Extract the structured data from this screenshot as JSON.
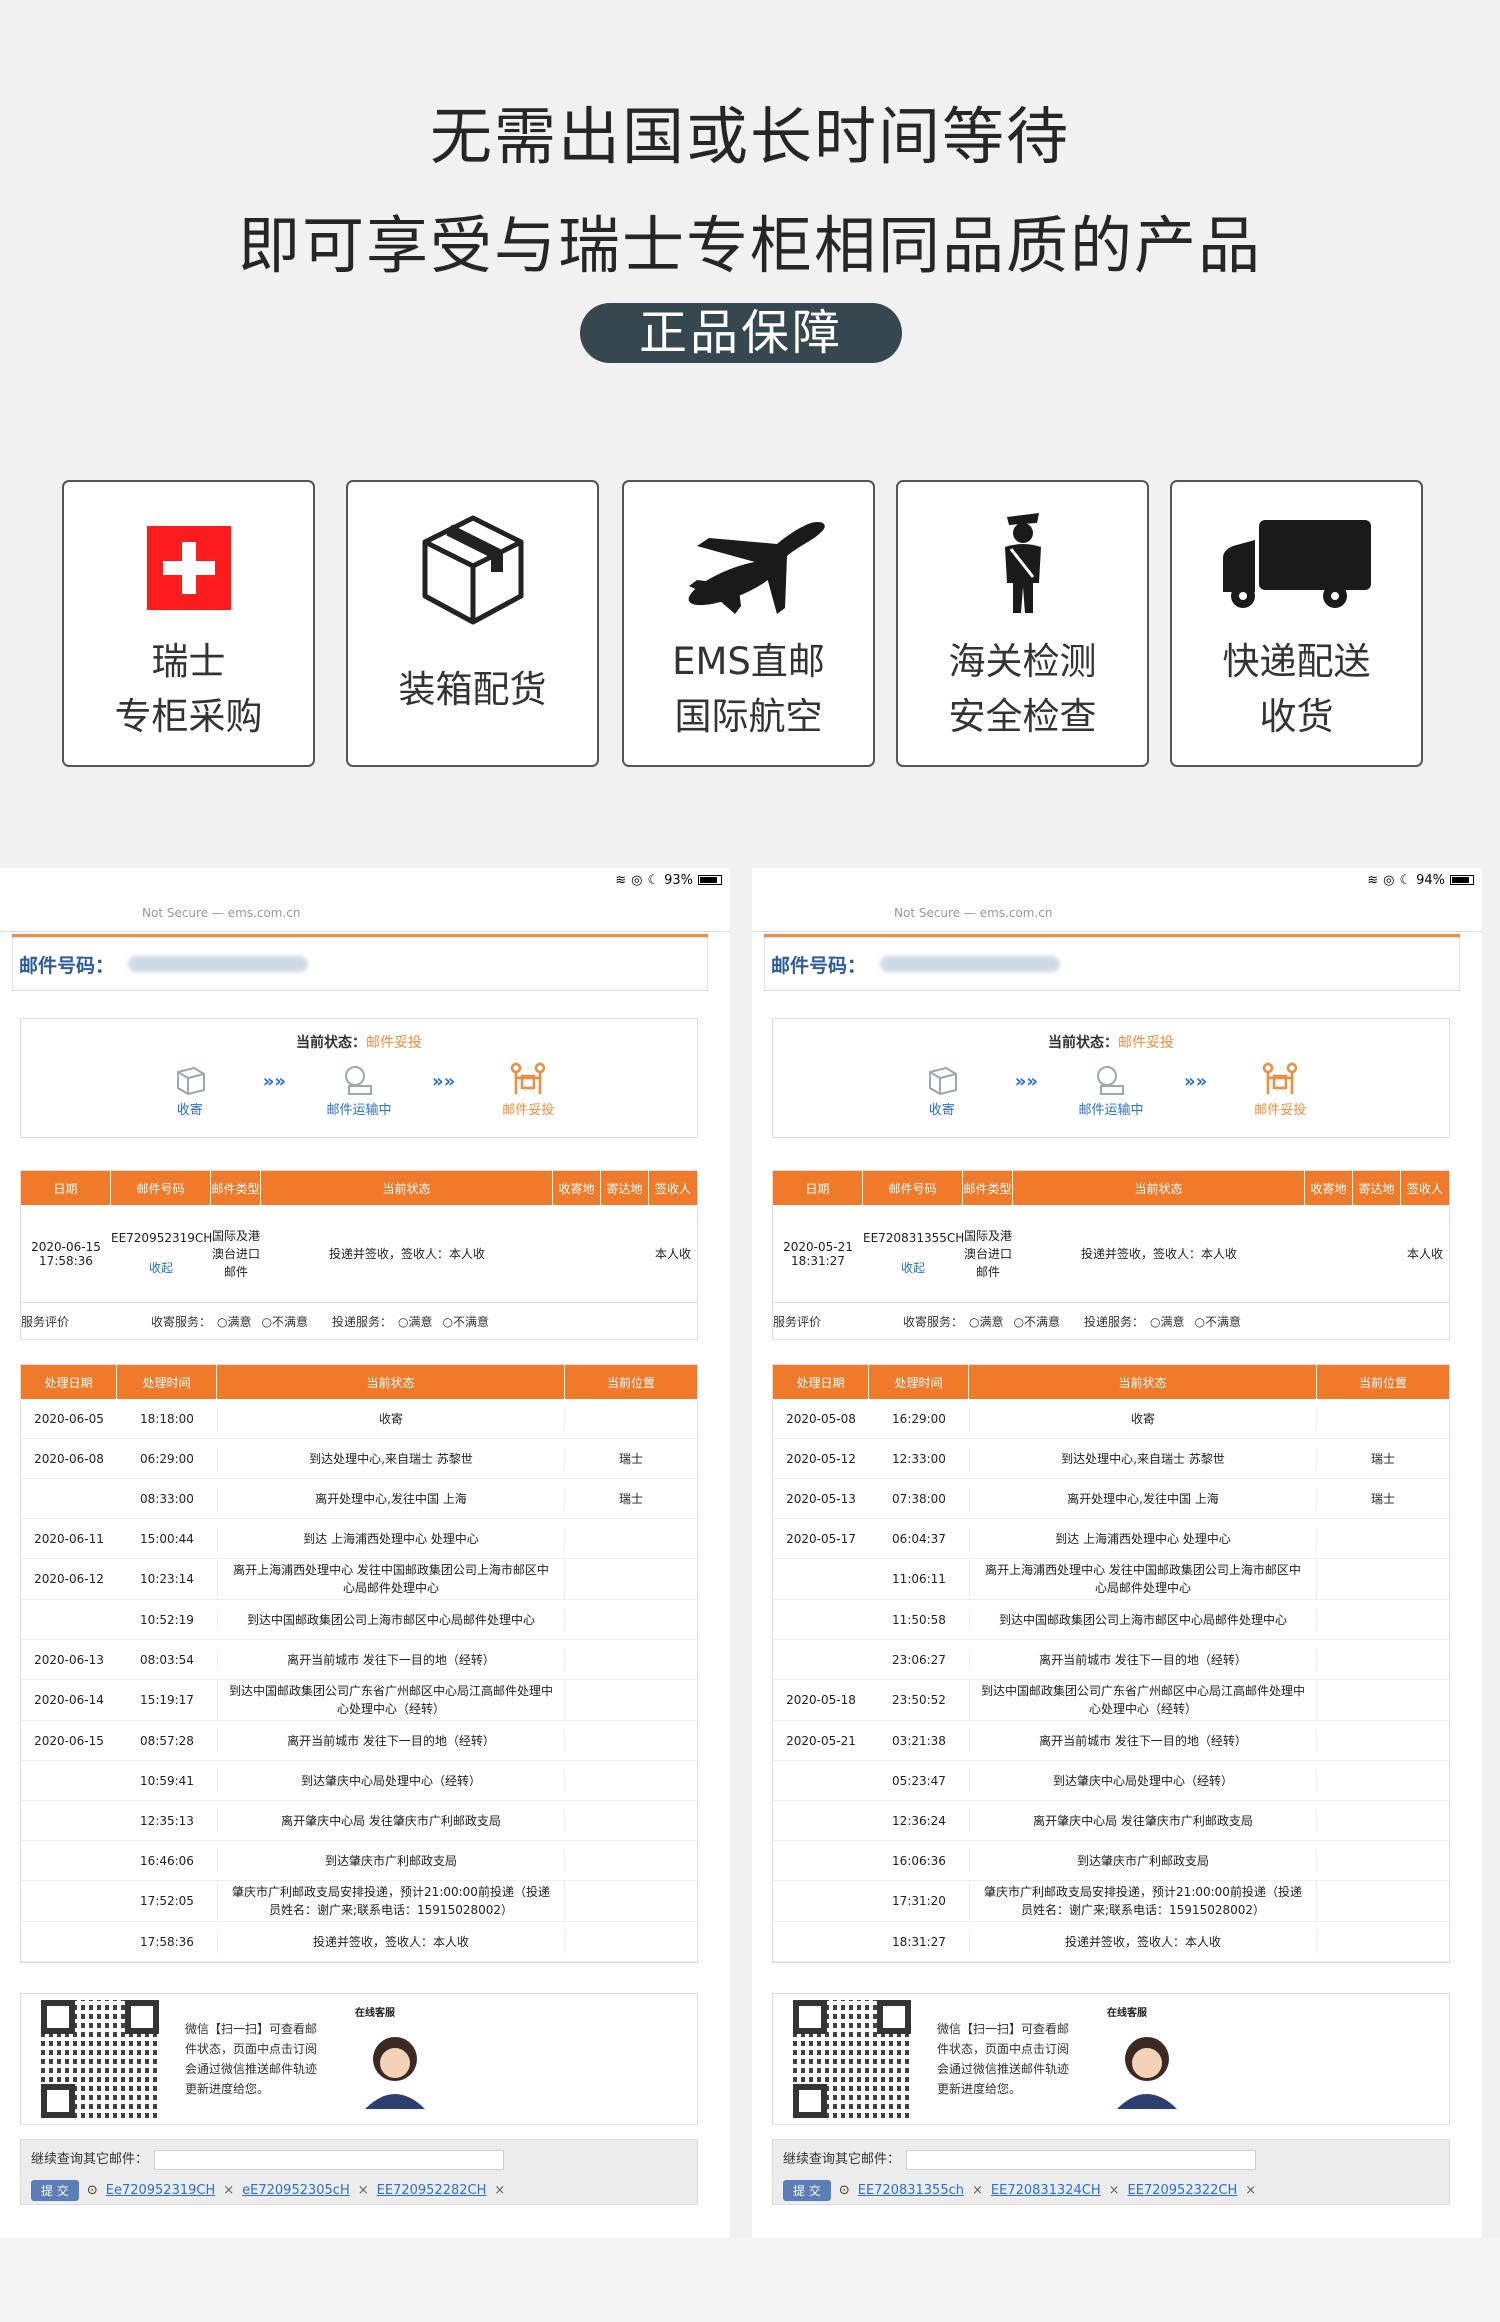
{
  "headline1": "无需出国或长时间等待",
  "headline2": "即可享受与瑞士专柜相同品质的产品",
  "badge": "正品保障",
  "features": [
    {
      "icon": "swiss-flag-icon",
      "l1": "瑞士",
      "l2": "专柜采购"
    },
    {
      "icon": "box-icon",
      "l1": "装箱配货",
      "l2": ""
    },
    {
      "icon": "airplane-icon",
      "l1": "EMS直邮",
      "l2": "国际航空"
    },
    {
      "icon": "customs-officer-icon",
      "l1": "海关检测",
      "l2": "安全检查"
    },
    {
      "icon": "truck-icon",
      "l1": "快递配送",
      "l2": "收货"
    }
  ],
  "shots": [
    {
      "status": {
        "battery": "93%"
      },
      "url": "Not Secure — ems.com.cn",
      "mail_label": "邮件号码：",
      "current_label": "当前状态：",
      "current_value": "邮件妥投",
      "steps": [
        "收寄",
        "邮件运输中",
        "邮件妥投"
      ],
      "t1_headers": [
        "日期",
        "邮件号码",
        "邮件类型",
        "当前状态",
        "收寄地",
        "寄达地",
        "签收人"
      ],
      "t1_row": {
        "date": "2020-06-15 17:58:36",
        "number": "EE720952319CH",
        "collect": "收起",
        "type": "国际及港澳台进口邮件",
        "state": "投递并签收，签收人：本人收",
        "signer": "本人收"
      },
      "service": {
        "label": "服务评价",
        "collect": "收寄服务：",
        "deliver": "投递服务：",
        "sat": "满意",
        "unsat": "不满意"
      },
      "t2_headers": [
        "处理日期",
        "处理时间",
        "当前状态",
        "当前位置"
      ],
      "t2_rows": [
        [
          "2020-06-05",
          "18:18:00",
          "收寄",
          ""
        ],
        [
          "2020-06-08",
          "06:29:00",
          "到达处理中心,来自瑞士 苏黎世",
          "瑞士"
        ],
        [
          "",
          "08:33:00",
          "离开处理中心,发往中国 上海",
          "瑞士"
        ],
        [
          "2020-06-11",
          "15:00:44",
          "到达 上海浦西处理中心 处理中心",
          ""
        ],
        [
          "2020-06-12",
          "10:23:14",
          "离开上海浦西处理中心 发往中国邮政集团公司上海市邮区中心局邮件处理中心",
          ""
        ],
        [
          "",
          "10:52:19",
          "到达中国邮政集团公司上海市邮区中心局邮件处理中心",
          ""
        ],
        [
          "2020-06-13",
          "08:03:54",
          "离开当前城市 发往下一目的地（经转）",
          ""
        ],
        [
          "2020-06-14",
          "15:19:17",
          "到达中国邮政集团公司广东省广州邮区中心局江高邮件处理中心处理中心（经转）",
          ""
        ],
        [
          "2020-06-15",
          "08:57:28",
          "离开当前城市 发往下一目的地（经转）",
          ""
        ],
        [
          "",
          "10:59:41",
          "到达肇庆中心局处理中心（经转）",
          ""
        ],
        [
          "",
          "12:35:13",
          "离开肇庆中心局 发往肇庆市广利邮政支局",
          ""
        ],
        [
          "",
          "16:46:06",
          "到达肇庆市广利邮政支局",
          ""
        ],
        [
          "",
          "17:52:05",
          "肇庆市广利邮政支局安排投递，预计21:00:00前投递（投递员姓名：谢广来;联系电话：15915028002）",
          ""
        ],
        [
          "",
          "17:58:36",
          "投递并签收，签收人：本人收",
          ""
        ]
      ],
      "qr_text": "微信【扫一扫】可查看邮件状态，页面中点击订阅会通过微信推送邮件轨迹更新进度给您。",
      "service_title": "在线客服",
      "more_label": "继续查询其它邮件：",
      "submit": "提 交",
      "history": [
        "Ee720952319CH",
        "eE720952305cH",
        "EE720952282CH"
      ]
    },
    {
      "status": {
        "battery": "94%"
      },
      "url": "Not Secure — ems.com.cn",
      "mail_label": "邮件号码：",
      "current_label": "当前状态：",
      "current_value": "邮件妥投",
      "steps": [
        "收寄",
        "邮件运输中",
        "邮件妥投"
      ],
      "t1_headers": [
        "日期",
        "邮件号码",
        "邮件类型",
        "当前状态",
        "收寄地",
        "寄达地",
        "签收人"
      ],
      "t1_row": {
        "date": "2020-05-21 18:31:27",
        "number": "EE720831355CH",
        "collect": "收起",
        "type": "国际及港澳台进口邮件",
        "state": "投递并签收，签收人：本人收",
        "signer": "本人收"
      },
      "service": {
        "label": "服务评价",
        "collect": "收寄服务：",
        "deliver": "投递服务：",
        "sat": "满意",
        "unsat": "不满意"
      },
      "t2_headers": [
        "处理日期",
        "处理时间",
        "当前状态",
        "当前位置"
      ],
      "t2_rows": [
        [
          "2020-05-08",
          "16:29:00",
          "收寄",
          ""
        ],
        [
          "2020-05-12",
          "12:33:00",
          "到达处理中心,来自瑞士 苏黎世",
          "瑞士"
        ],
        [
          "2020-05-13",
          "07:38:00",
          "离开处理中心,发往中国 上海",
          "瑞士"
        ],
        [
          "2020-05-17",
          "06:04:37",
          "到达 上海浦西处理中心 处理中心",
          ""
        ],
        [
          "",
          "11:06:11",
          "离开上海浦西处理中心 发往中国邮政集团公司上海市邮区中心局邮件处理中心",
          ""
        ],
        [
          "",
          "11:50:58",
          "到达中国邮政集团公司上海市邮区中心局邮件处理中心",
          ""
        ],
        [
          "",
          "23:06:27",
          "离开当前城市 发往下一目的地（经转）",
          ""
        ],
        [
          "2020-05-18",
          "23:50:52",
          "到达中国邮政集团公司广东省广州邮区中心局江高邮件处理中心处理中心（经转）",
          ""
        ],
        [
          "2020-05-21",
          "03:21:38",
          "离开当前城市 发往下一目的地（经转）",
          ""
        ],
        [
          "",
          "05:23:47",
          "到达肇庆中心局处理中心（经转）",
          ""
        ],
        [
          "",
          "12:36:24",
          "离开肇庆中心局 发往肇庆市广利邮政支局",
          ""
        ],
        [
          "",
          "16:06:36",
          "到达肇庆市广利邮政支局",
          ""
        ],
        [
          "",
          "17:31:20",
          "肇庆市广利邮政支局安排投递，预计21:00:00前投递（投递员姓名：谢广来;联系电话：15915028002）",
          ""
        ],
        [
          "",
          "18:31:27",
          "投递并签收，签收人：本人收",
          ""
        ]
      ],
      "qr_text": "微信【扫一扫】可查看邮件状态，页面中点击订阅会通过微信推送邮件轨迹更新进度给您。",
      "service_title": "在线客服",
      "more_label": "继续查询其它邮件：",
      "submit": "提 交",
      "history": [
        "EE720831355ch",
        "EE720831324CH",
        "EE720952322CH"
      ]
    }
  ]
}
